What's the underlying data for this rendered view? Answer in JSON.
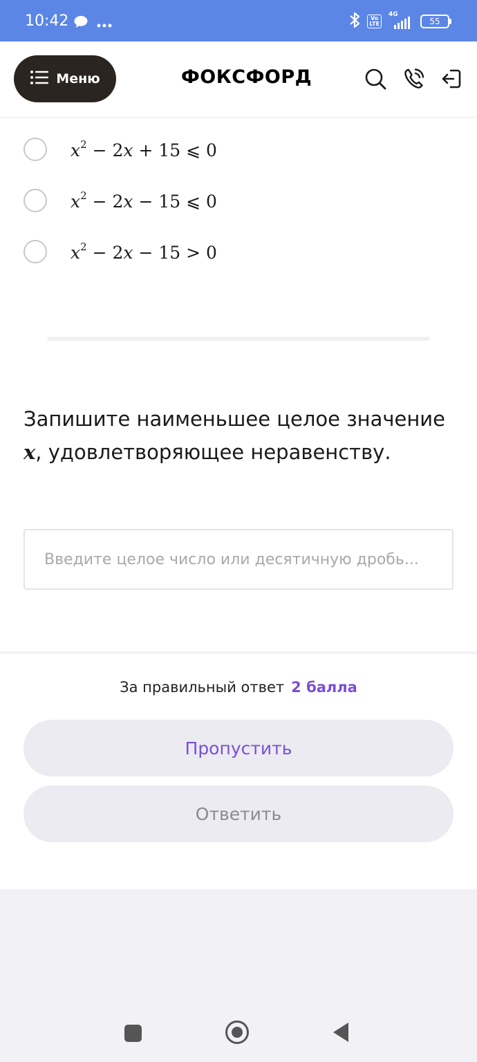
{
  "status_bar": {
    "time": "10:42",
    "volte_label": "Vo\nLTE",
    "network_label": "4G",
    "battery": "55"
  },
  "header": {
    "menu_label": "Меню",
    "logo": "ФОКСФОРД"
  },
  "options": [
    {
      "base": "x",
      "exp": "2",
      "rest": " − 2",
      "var": "x",
      "tail": " + 15 ⩽ 0"
    },
    {
      "base": "x",
      "exp": "2",
      "rest": " − 2",
      "var": "x",
      "tail": " − 15 ⩽ 0"
    },
    {
      "base": "x",
      "exp": "2",
      "rest": " − 2",
      "var": "x",
      "tail": " − 15 > 0"
    }
  ],
  "question": {
    "text_before": "Запишите наименьшее целое значение ",
    "variable": "x",
    "text_after": ", удовлетворяющее неравенству."
  },
  "answer": {
    "placeholder": "Введите целое число или десятичную дробь..."
  },
  "footer": {
    "points_label": "За правильный ответ",
    "points_value": "2 балла",
    "skip_label": "Пропустить",
    "answer_label": "Ответить"
  },
  "colors": {
    "status_bar": "#5b86e5",
    "accent": "#7a4fd6",
    "menu_button": "#2a2520"
  }
}
